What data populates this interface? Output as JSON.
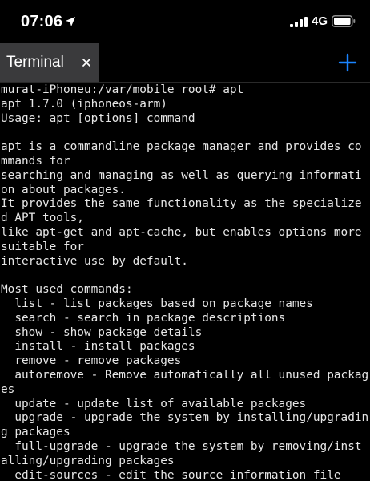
{
  "status_bar": {
    "time": "07:06",
    "network": "4G"
  },
  "tab_bar": {
    "tab_label": "Terminal",
    "close_symbol": "×",
    "add_symbol": "+"
  },
  "icons": {
    "location": "location-arrow-icon",
    "signal": "cellular-signal-icon",
    "battery": "battery-icon",
    "close": "close-icon",
    "add": "plus-icon"
  },
  "colors": {
    "background": "#000000",
    "tab_active": "#3a3a3c",
    "accent": "#1a84ff",
    "text": "#e6e6e6"
  },
  "terminal": {
    "lines": [
      "murat-iPhoneu:/var/mobile root# apt",
      "apt 1.7.0 (iphoneos-arm)",
      "Usage: apt [options] command",
      "",
      "apt is a commandline package manager and provides co",
      "mmands for",
      "searching and managing as well as querying informati",
      "on about packages.",
      "It provides the same functionality as the specialize",
      "d APT tools,",
      "like apt-get and apt-cache, but enables options more",
      "suitable for",
      "interactive use by default.",
      "",
      "Most used commands:",
      "  list - list packages based on package names",
      "  search - search in package descriptions",
      "  show - show package details",
      "  install - install packages",
      "  remove - remove packages",
      "  autoremove - Remove automatically all unused packag",
      "es",
      "  update - update list of available packages",
      "  upgrade - upgrade the system by installing/upgradin",
      "g packages",
      "  full-upgrade - upgrade the system by removing/inst",
      "alling/upgrading packages",
      "  edit-sources - edit the source information file"
    ]
  }
}
